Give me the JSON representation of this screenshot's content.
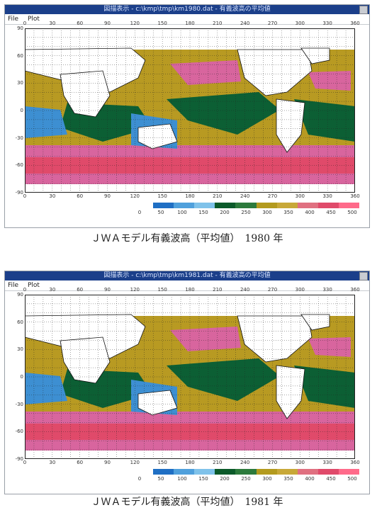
{
  "panels": [
    {
      "window_title": "図描表示 - c:\\kmp\\tmp\\km1980.dat - 有義波高の平均値",
      "menu": [
        "File",
        "Plot"
      ],
      "caption": "ＪＷＡモデル有義波高（平均値）　1980 年"
    },
    {
      "window_title": "図描表示 - c:\\kmp\\tmp\\km1981.dat - 有義波高の平均値",
      "menu": [
        "File",
        "Plot"
      ],
      "caption": "ＪＷＡモデル有義波高（平均値）　1981 年"
    }
  ],
  "longitude_labels": [
    "0",
    "30",
    "60",
    "90",
    "120",
    "150",
    "180",
    "210",
    "240",
    "270",
    "300",
    "330",
    "360"
  ],
  "latitude_labels": [
    "90",
    "60",
    "30",
    "0",
    "-30",
    "-60",
    "-90"
  ],
  "legend": {
    "ticks": [
      "0",
      "50",
      "100",
      "150",
      "200",
      "250",
      "300",
      "350",
      "400",
      "450",
      "500"
    ],
    "colors": [
      "#ffffff",
      "#1f6fc4",
      "#4fa0dc",
      "#7fc2ea",
      "#0b5a2a",
      "#2c7a3c",
      "#b39a1e",
      "#c8a838",
      "#e07080",
      "#e04a6a",
      "#ff6a8a"
    ]
  },
  "map_colors": {
    "land": "#ffffff",
    "low": "#3d8fd2",
    "mid": "#0c5f34",
    "upper": "#b89a22",
    "high": "#d8659e"
  }
}
